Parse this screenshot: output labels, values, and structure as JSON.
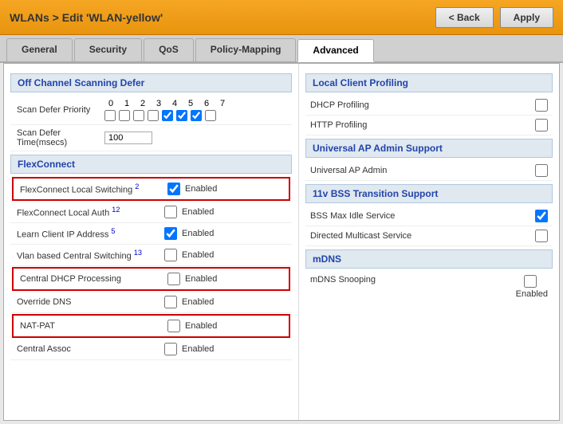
{
  "titlebar": {
    "breadcrumb": "WLANs > Edit  'WLAN-yellow'",
    "back_label": "< Back",
    "apply_label": "Apply"
  },
  "tabs": [
    {
      "id": "general",
      "label": "General",
      "active": false
    },
    {
      "id": "security",
      "label": "Security",
      "active": false
    },
    {
      "id": "qos",
      "label": "QoS",
      "active": false
    },
    {
      "id": "policy-mapping",
      "label": "Policy-Mapping",
      "active": false
    },
    {
      "id": "advanced",
      "label": "Advanced",
      "active": true
    }
  ],
  "left": {
    "off_channel_section": "Off Channel Scanning Defer",
    "scan_defer_priority_label": "Scan Defer Priority",
    "priority_numbers": [
      "0",
      "1",
      "2",
      "3",
      "4",
      "5",
      "6",
      "7"
    ],
    "priority_checked": [
      false,
      false,
      false,
      false,
      true,
      true,
      true,
      false
    ],
    "scan_defer_time_label": "Scan Defer Time(msecs)",
    "scan_defer_time_value": "100",
    "flexconnect_section": "FlexConnect",
    "flex_rows": [
      {
        "id": "local-switching",
        "label": "FlexConnect Local Switching",
        "superscript": "2",
        "checked": true,
        "enabled_label": "Enabled",
        "highlighted": true
      },
      {
        "id": "local-auth",
        "label": "FlexConnect Local Auth",
        "superscript": "12",
        "checked": false,
        "enabled_label": "Enabled",
        "highlighted": false
      },
      {
        "id": "learn-client-ip",
        "label": "Learn Client IP Address",
        "superscript": "5",
        "checked": true,
        "enabled_label": "Enabled",
        "highlighted": false
      },
      {
        "id": "vlan-central-switching",
        "label": "Vlan based Central Switching",
        "superscript": "13",
        "checked": false,
        "enabled_label": "Enabled",
        "highlighted": false
      },
      {
        "id": "central-dhcp",
        "label": "Central DHCP Processing",
        "superscript": "",
        "checked": false,
        "enabled_label": "Enabled",
        "highlighted": true
      },
      {
        "id": "override-dns",
        "label": "Override DNS",
        "superscript": "",
        "checked": false,
        "enabled_label": "Enabled",
        "highlighted": false
      },
      {
        "id": "nat-pat",
        "label": "NAT-PAT",
        "superscript": "",
        "checked": false,
        "enabled_label": "Enabled",
        "highlighted": true
      },
      {
        "id": "central-assoc",
        "label": "Central Assoc",
        "superscript": "",
        "checked": false,
        "enabled_label": "Enabled",
        "highlighted": false
      }
    ]
  },
  "right": {
    "local_client_section": "Local Client Profiling",
    "dhcp_profiling_label": "DHCP Profiling",
    "dhcp_profiling_checked": false,
    "http_profiling_label": "HTTP Profiling",
    "http_profiling_checked": false,
    "universal_ap_section": "Universal AP Admin Support",
    "universal_ap_label": "Universal AP Admin",
    "universal_ap_checked": false,
    "bss_section": "11v BSS Transition Support",
    "bss_max_idle_label": "BSS Max Idle Service",
    "bss_max_idle_checked": true,
    "directed_multicast_label": "Directed Multicast Service",
    "directed_multicast_checked": false,
    "mdns_section": "mDNS",
    "mdns_snooping_label": "mDNS Snooping",
    "mdns_snooping_checked": false,
    "mdns_enabled_label": "Enabled"
  }
}
